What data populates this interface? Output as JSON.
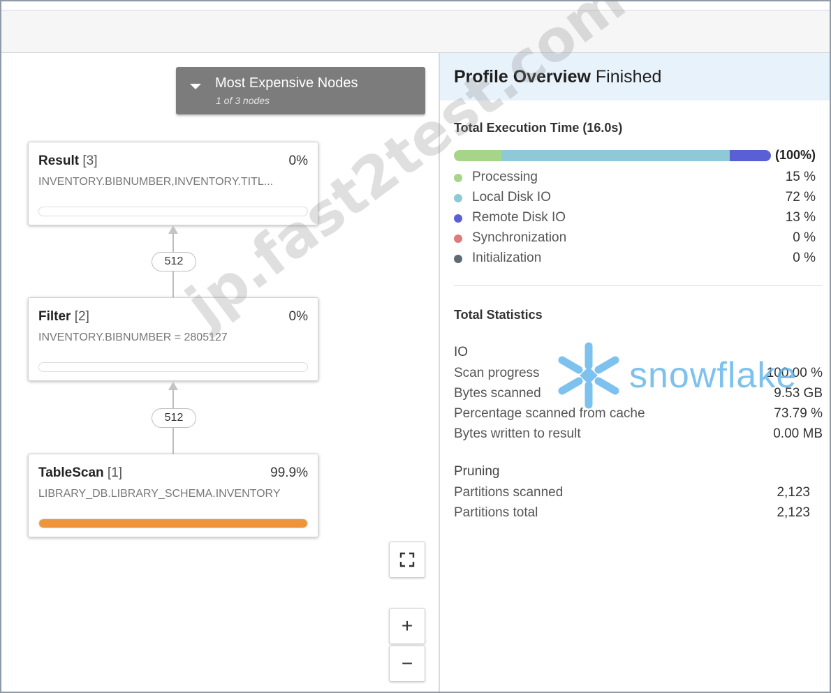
{
  "graph": {
    "expensive_nodes": {
      "title": "Most Expensive Nodes",
      "subtitle": "1 of 3 nodes"
    },
    "nodes": [
      {
        "name": "Result",
        "index": "[3]",
        "percent": "0%",
        "description": "INVENTORY.BIBNUMBER,INVENTORY.TITL...",
        "fill": 0
      },
      {
        "name": "Filter",
        "index": "[2]",
        "percent": "0%",
        "description": "INVENTORY.BIBNUMBER = 2805127",
        "fill": 0
      },
      {
        "name": "TableScan",
        "index": "[1]",
        "percent": "99.9%",
        "description": "LIBRARY_DB.LIBRARY_SCHEMA.INVENTORY",
        "fill": 0.999
      }
    ],
    "edges": [
      {
        "rows": "512"
      },
      {
        "rows": "512"
      }
    ],
    "controls": {
      "zoom_in": "+",
      "zoom_out": "−"
    }
  },
  "profile": {
    "title": "Profile Overview",
    "status": "Finished",
    "execution": {
      "title": "Total Execution Time (16.0s)",
      "total": "(100%)",
      "breakdown": [
        {
          "label": "Processing",
          "value": "15 %",
          "fraction": 0.15,
          "color": "#a6d58a"
        },
        {
          "label": "Local Disk IO",
          "value": "72 %",
          "fraction": 0.72,
          "color": "#8fc8d6"
        },
        {
          "label": "Remote Disk IO",
          "value": "13 %",
          "fraction": 0.13,
          "color": "#5a5fd6"
        },
        {
          "label": "Synchronization",
          "value": "0 %",
          "fraction": 0,
          "color": "#e07a7a"
        },
        {
          "label": "Initialization",
          "value": "0 %",
          "fraction": 0,
          "color": "#5f6a73"
        }
      ]
    },
    "statistics": {
      "title": "Total Statistics",
      "io": {
        "title": "IO",
        "rows": [
          {
            "label": "Scan progress",
            "value": "100.00 %"
          },
          {
            "label": "Bytes scanned",
            "value": "9.53 GB"
          },
          {
            "label": "Percentage scanned from cache",
            "value": "73.79 %"
          },
          {
            "label": "Bytes written to result",
            "value": "0.00 MB"
          }
        ]
      },
      "pruning": {
        "title": "Pruning",
        "rows": [
          {
            "label": "Partitions scanned",
            "value": "2,123"
          },
          {
            "label": "Partitions total",
            "value": "2,123"
          }
        ]
      }
    }
  },
  "branding": {
    "logo_text": "snowflake",
    "watermark": "jp.fast2test.com"
  }
}
